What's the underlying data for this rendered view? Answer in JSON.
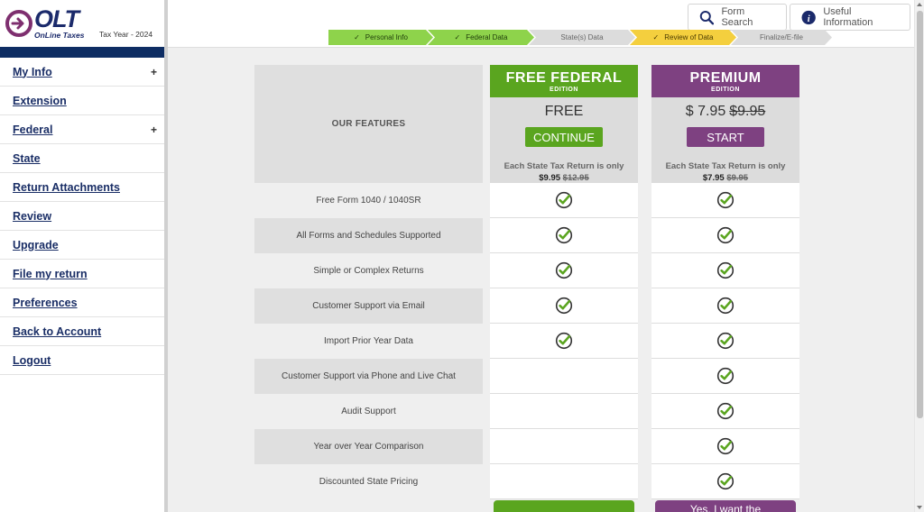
{
  "brand": {
    "logo_text": "OLT",
    "logo_sub": "OnLine Taxes",
    "tax_year": "Tax Year - 2024"
  },
  "sidebar": {
    "items": [
      {
        "label": "My Info",
        "expandable": true
      },
      {
        "label": "Extension",
        "expandable": false
      },
      {
        "label": "Federal",
        "expandable": true
      },
      {
        "label": "State",
        "expandable": false
      },
      {
        "label": "Return Attachments",
        "expandable": false
      },
      {
        "label": "Review",
        "expandable": false
      },
      {
        "label": "Upgrade",
        "expandable": false
      },
      {
        "label": "File my return",
        "expandable": false
      },
      {
        "label": "Preferences",
        "expandable": false
      },
      {
        "label": "Back to Account",
        "expandable": false
      },
      {
        "label": "Logout",
        "expandable": false
      }
    ],
    "expand_symbol": "+"
  },
  "topbar": {
    "form_search": "Form Search",
    "useful_info": "Useful Information"
  },
  "progress": {
    "check": "✓",
    "steps": [
      {
        "label": "Personal Info",
        "state": "done"
      },
      {
        "label": "Federal Data",
        "state": "done"
      },
      {
        "label": "State(s) Data",
        "state": "todo"
      },
      {
        "label": "Review of Data",
        "state": "current"
      },
      {
        "label": "Finalize/E-file",
        "state": "todo"
      }
    ]
  },
  "pricing": {
    "features_header": "OUR FEATURES",
    "free": {
      "name": "FREE FEDERAL",
      "edition": "EDITION",
      "price": "FREE",
      "cta": "CONTINUE",
      "note": "Each State Tax Return is only",
      "state_price": "$9.95",
      "state_old_price": "$12.95",
      "color": "#5aa51f"
    },
    "premium": {
      "name": "PREMIUM",
      "edition": "EDITION",
      "price": "$ 7.95",
      "old_price": "$9.95",
      "cta": "START",
      "note": "Each State Tax Return is only",
      "state_price": "$7.95",
      "state_old_price": "$9.95",
      "color": "#7e4181",
      "bottom_cta": "Yes, I want the"
    },
    "features": [
      {
        "label": "Free Form 1040 / 1040SR",
        "free": true,
        "premium": true
      },
      {
        "label": "All Forms and Schedules Supported",
        "free": true,
        "premium": true
      },
      {
        "label": "Simple or Complex Returns",
        "free": true,
        "premium": true
      },
      {
        "label": "Customer Support via Email",
        "free": true,
        "premium": true
      },
      {
        "label": "Import Prior Year Data",
        "free": true,
        "premium": true
      },
      {
        "label": "Customer Support via Phone and Live Chat",
        "free": false,
        "premium": true
      },
      {
        "label": "Audit Support",
        "free": false,
        "premium": true
      },
      {
        "label": "Year over Year Comparison",
        "free": false,
        "premium": true
      },
      {
        "label": "Discounted State Pricing",
        "free": false,
        "premium": true
      }
    ],
    "check_color": "#5aa51f"
  }
}
